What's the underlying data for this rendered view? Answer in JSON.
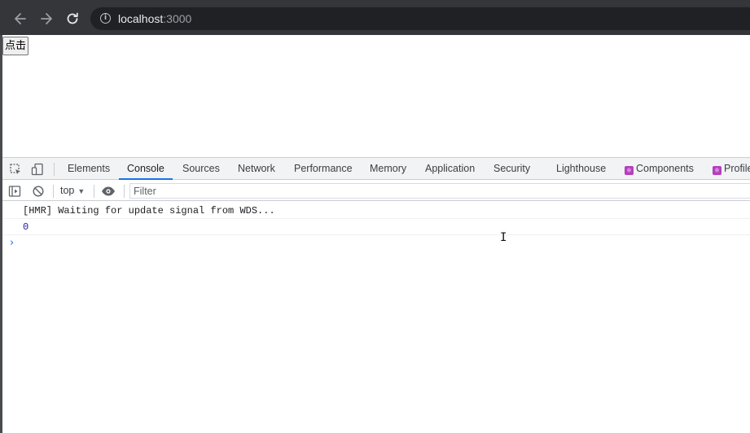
{
  "browser": {
    "url_host": "localhost",
    "url_port": ":3000",
    "back_icon": "arrow-left",
    "forward_icon": "arrow-right",
    "reload_icon": "reload",
    "site_info_icon": "info"
  },
  "page": {
    "button_label": "点击"
  },
  "devtools": {
    "tabs": [
      "Elements",
      "Console",
      "Sources",
      "Network",
      "Performance",
      "Memory",
      "Application",
      "Security",
      "Lighthouse",
      "Components",
      "Profiler"
    ],
    "selected_tab": "Console",
    "console": {
      "context": "top",
      "filter_placeholder": "Filter",
      "messages": [
        "[HMR] Waiting for update signal from WDS...",
        "0"
      ],
      "prompt": "›"
    },
    "accent_color": "#1a73e8"
  }
}
